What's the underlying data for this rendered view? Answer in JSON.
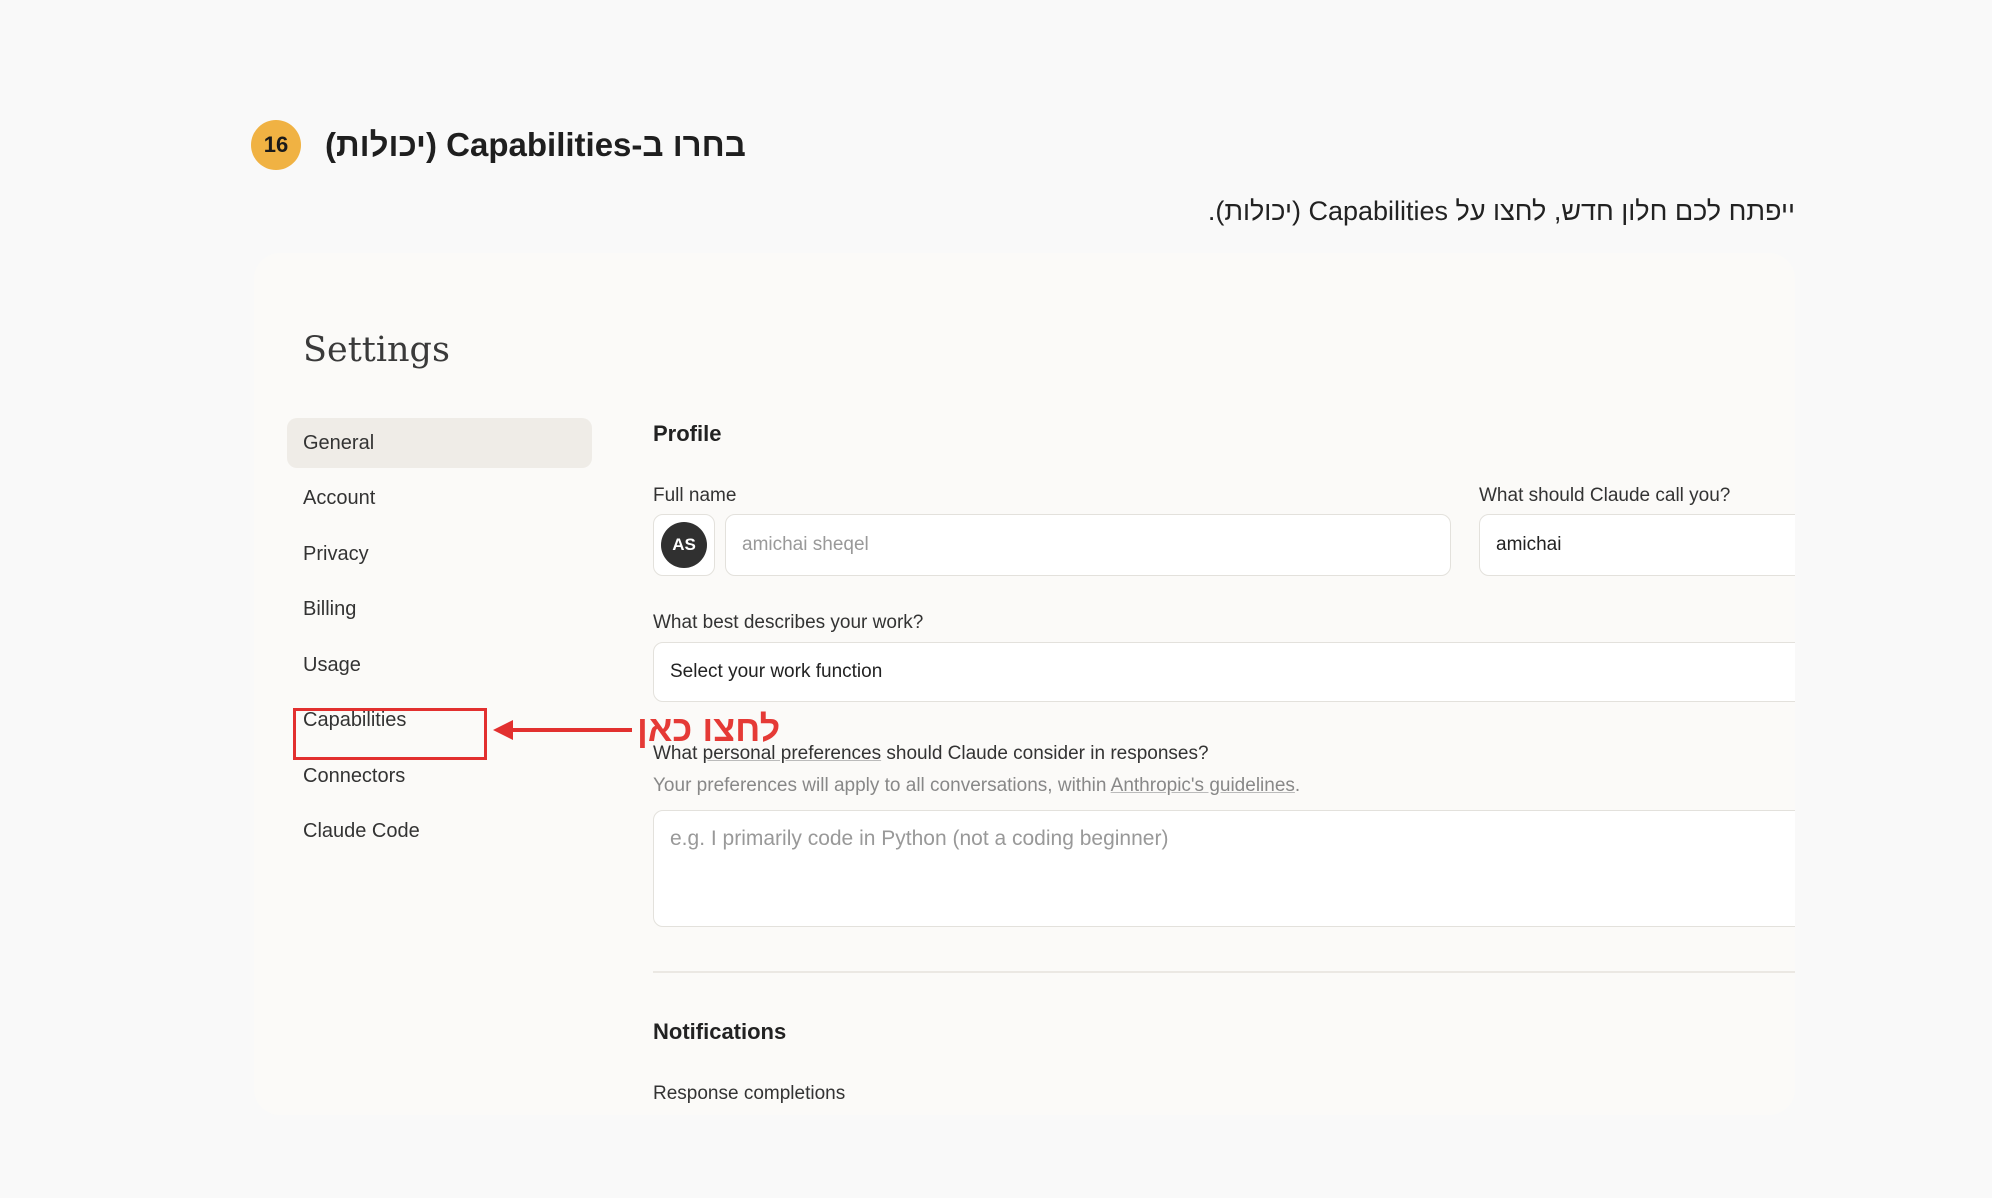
{
  "step": {
    "number": "16",
    "title": "בחרו ב-Capabilities (יכולות)",
    "description": "ייפתח לכם חלון חדש, לחצו על Capabilities (יכולות)."
  },
  "annotation": {
    "click_here": "לחצו כאן",
    "color": "#e2302f"
  },
  "settings": {
    "title": "Settings",
    "nav": [
      {
        "label": "General",
        "active": true
      },
      {
        "label": "Account"
      },
      {
        "label": "Privacy"
      },
      {
        "label": "Billing"
      },
      {
        "label": "Usage"
      },
      {
        "label": "Capabilities"
      },
      {
        "label": "Connectors"
      },
      {
        "label": "Claude Code"
      }
    ]
  },
  "profile": {
    "section_title": "Profile",
    "full_name_label": "Full name",
    "avatar_initials": "AS",
    "full_name_value": "amichai sheqel",
    "call_label": "What should Claude call you?",
    "call_value": "amichai",
    "work_label": "What best describes your work?",
    "work_select": "Select your work function",
    "prefs_label_prefix": "What ",
    "prefs_label_link": "personal preferences",
    "prefs_label_suffix": " should Claude consider in responses?",
    "prefs_sub_prefix": "Your preferences will apply to all conversations, within ",
    "prefs_sub_link": "Anthropic's guidelines",
    "prefs_sub_suffix": ".",
    "prefs_placeholder": "e.g. I primarily code in Python (not a coding beginner)"
  },
  "notifications": {
    "section_title": "Notifications",
    "response_completions": "Response completions"
  }
}
